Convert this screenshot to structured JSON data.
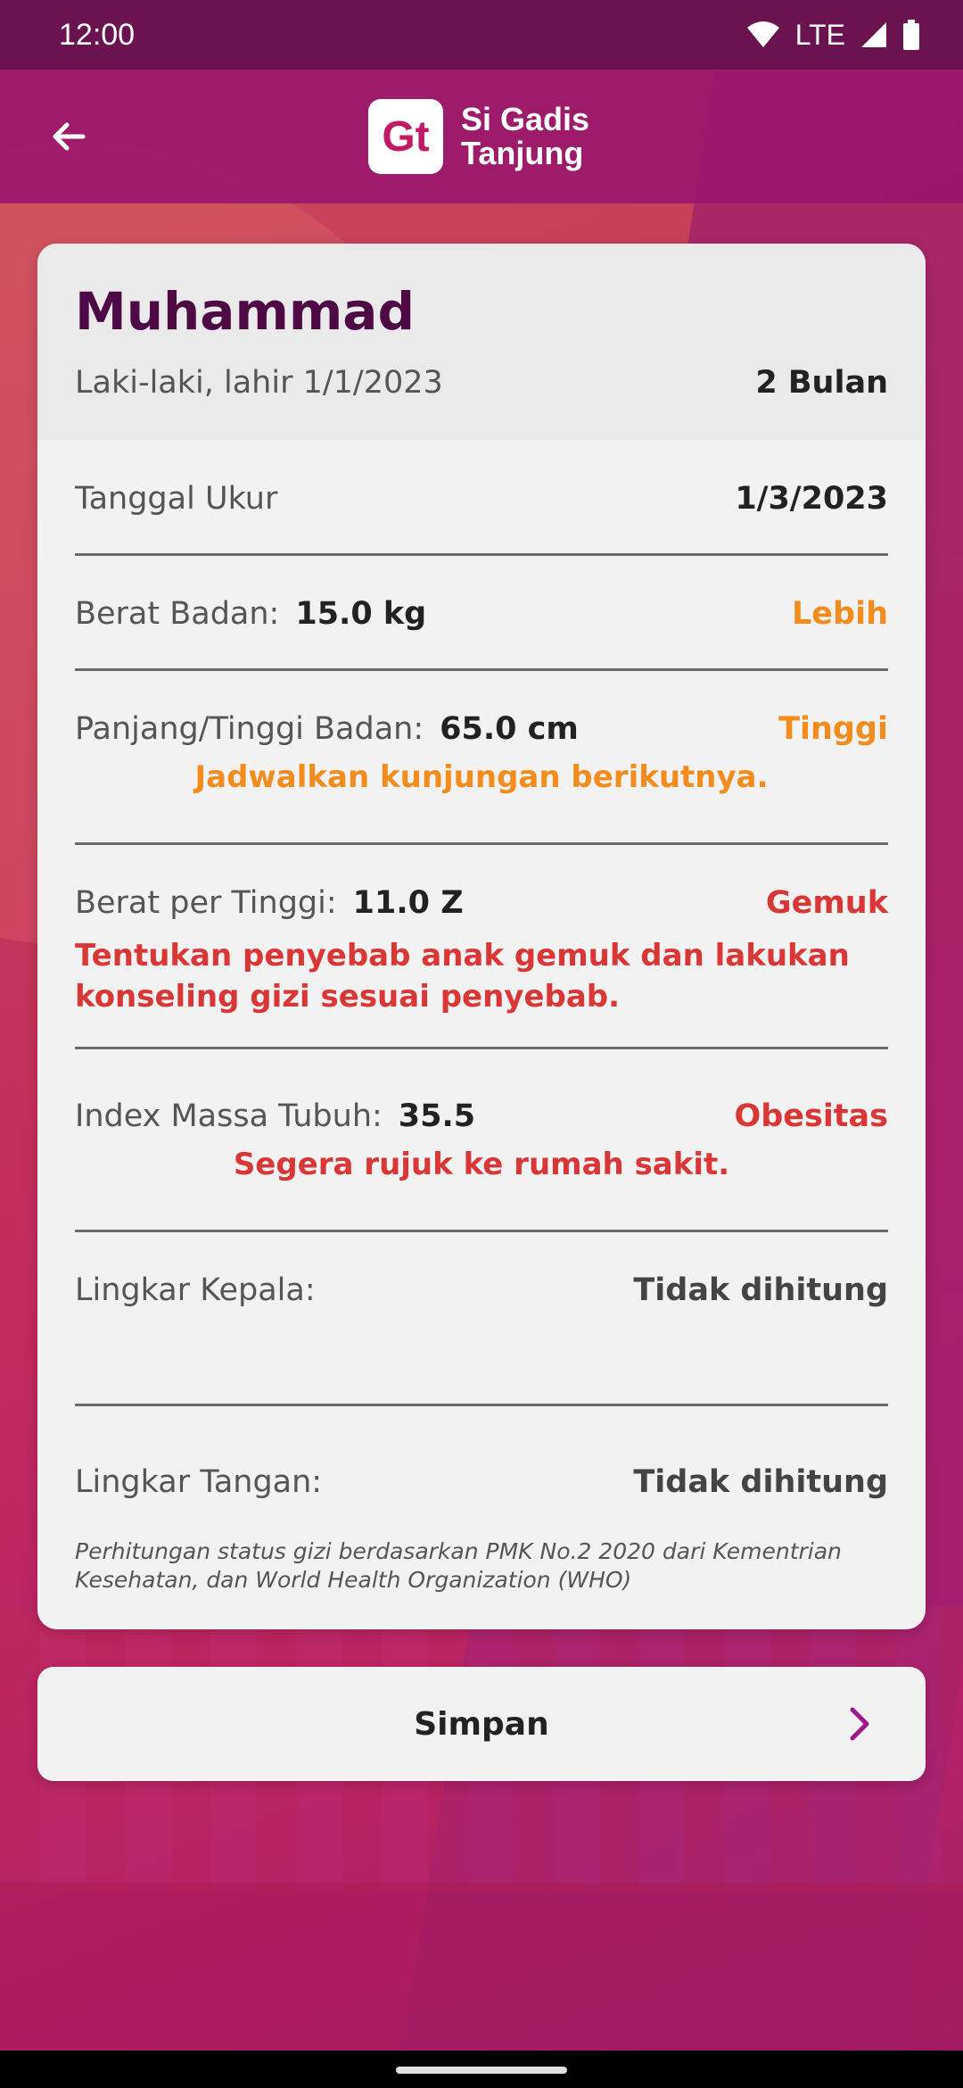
{
  "status_bar": {
    "time": "12:00",
    "network": "LTE"
  },
  "app_bar": {
    "logo_mark": "Gt",
    "logo_line1": "Si Gadis",
    "logo_line2": "Tanjung"
  },
  "profile": {
    "name": "Muhammad",
    "subtitle": "Laki-laki, lahir 1/1/2023",
    "age": "2 Bulan"
  },
  "rows": {
    "tanggal": {
      "label": "Tanggal Ukur",
      "value": "1/3/2023"
    },
    "berat": {
      "label": "Berat Badan:",
      "value": "15.0 kg",
      "status": "Lebih"
    },
    "tinggi": {
      "label": "Panjang/Tinggi Badan:",
      "value": "65.0 cm",
      "status": "Tinggi",
      "note": "Jadwalkan kunjungan berikutnya."
    },
    "bpt": {
      "label": "Berat per Tinggi:",
      "value": "11.0 Z",
      "status": "Gemuk",
      "note": "Tentukan penyebab anak gemuk dan lakukan konseling gizi sesuai penyebab."
    },
    "imt": {
      "label": "Index Massa Tubuh:",
      "value": "35.5",
      "status": "Obesitas",
      "note": "Segera rujuk ke rumah sakit."
    },
    "kepala": {
      "label": "Lingkar Kepala:",
      "status": "Tidak dihitung"
    },
    "tangan": {
      "label": "Lingkar Tangan:",
      "status": "Tidak dihitung"
    }
  },
  "footnote": "Perhitungan status gizi berdasarkan PMK No.2 2020 dari Kementrian Kesehatan, dan World Health Organization (WHO)",
  "save_button": {
    "label": "Simpan"
  },
  "colors": {
    "warning": "#f28c1d",
    "danger": "#d93636",
    "primary_dark": "#4e0a45"
  }
}
